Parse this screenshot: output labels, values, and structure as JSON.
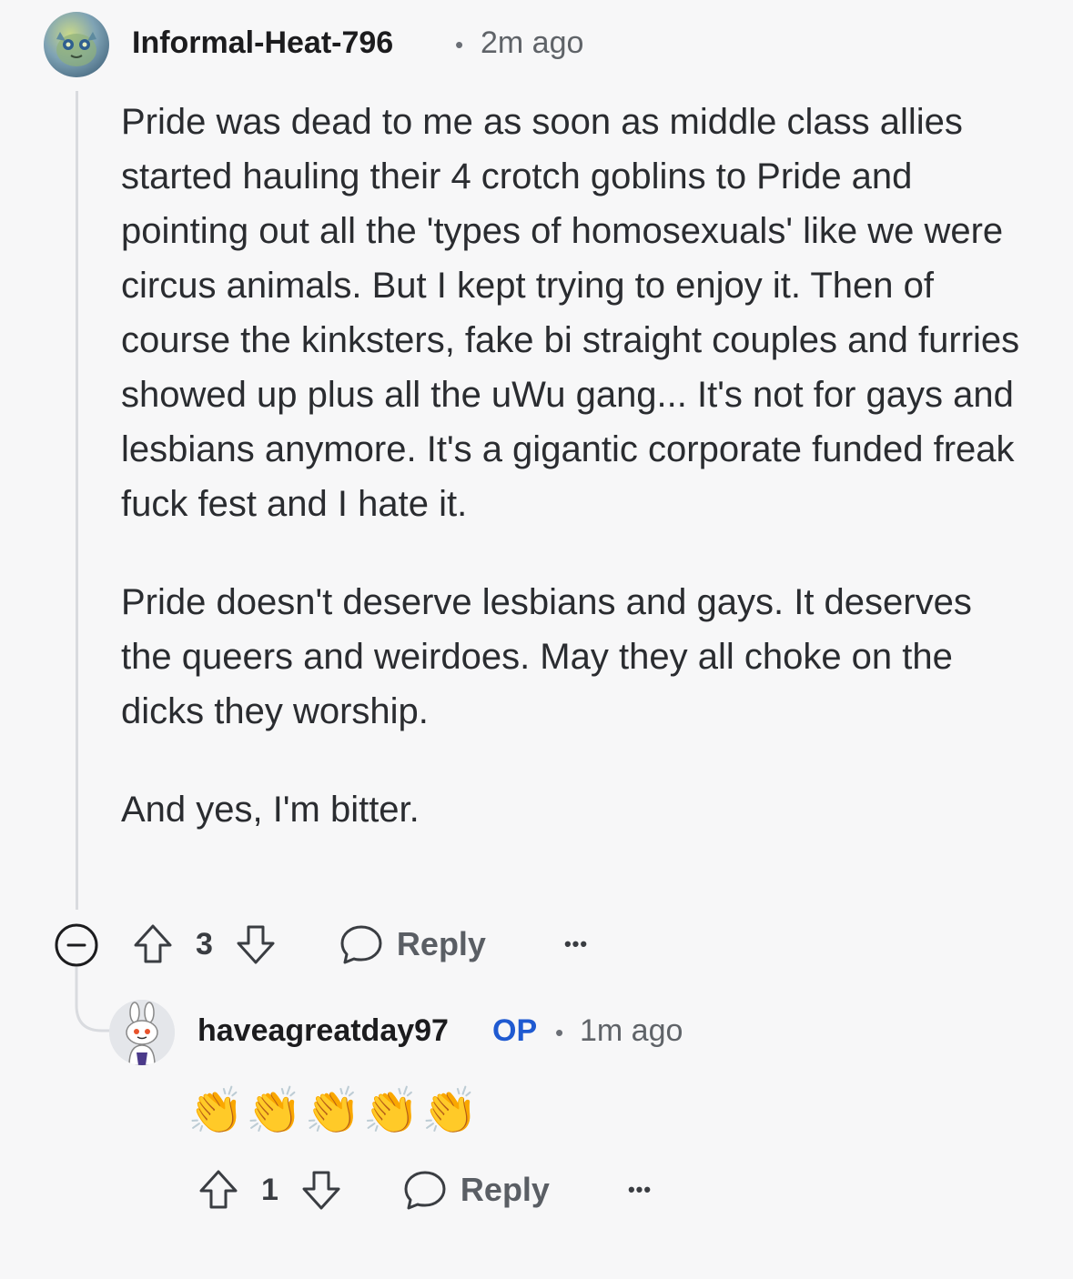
{
  "comment": {
    "author": "Informal-Heat-796",
    "separator": "•",
    "time": "2m ago",
    "paragraphs": [
      "Pride was dead to me as soon as middle class allies started hauling their 4 crotch goblins to Pride and pointing out all the 'types of homosexuals' like we were circus animals. But I kept trying to enjoy it. Then of course the kinksters, fake bi straight couples and furries showed up plus all the uWu gang... It's not for gays and lesbians anymore. It's a gigantic corporate funded freak fuck fest and I hate it.",
      "Pride doesn't deserve lesbians and gays. It deserves the queers and weirdoes. May they all choke on the dicks they worship.",
      "And yes, I'm bitter."
    ],
    "votes": "3",
    "reply_label": "Reply",
    "more_label": "•••"
  },
  "reply": {
    "author": "haveagreatday97",
    "op_badge": "OP",
    "separator": "•",
    "time": "1m ago",
    "body": "👏👏👏👏👏",
    "votes": "1",
    "reply_label": "Reply",
    "more_label": "•••"
  },
  "icons": [
    "collapse-icon",
    "upvote-icon",
    "downvote-icon",
    "comment-bubble-icon",
    "more-icon"
  ],
  "colors": {
    "background": "#f7f7f8",
    "op_blue": "#1f5ad1",
    "thread_line": "#d9dbdf"
  }
}
